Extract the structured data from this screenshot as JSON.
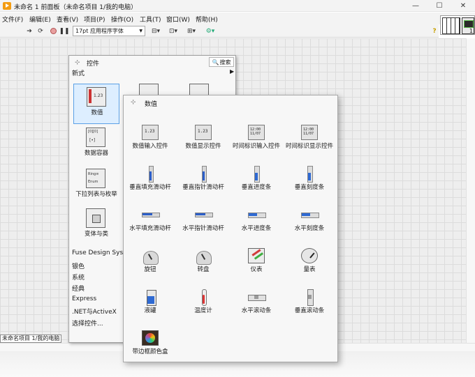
{
  "window": {
    "title": "未命名 1 前面板（未命名项目 1/我的电脑）",
    "minimize": "—",
    "maximize": "☐",
    "close": "✕"
  },
  "menu": [
    "文件(F)",
    "编辑(E)",
    "查看(V)",
    "项目(P)",
    "操作(O)",
    "工具(T)",
    "窗口(W)",
    "帮助(H)"
  ],
  "toolbar": {
    "font": "17pt 应用程序字体",
    "help": "?",
    "connector_number": "1"
  },
  "status_label": "未命名项目 1/我的电脑",
  "palette": {
    "title": "控件",
    "search": "搜索",
    "subtitle": "新式",
    "categories": [
      "数值",
      "数据容器",
      "下拉列表与枚举",
      "变体与类"
    ],
    "categories_selected": "数值",
    "list": [
      "Fuse Design Syste",
      "银色",
      "系统",
      "经典",
      "Express",
      ".NET与ActiveX",
      "选择控件..."
    ]
  },
  "subpalette": {
    "title": "数值",
    "items": [
      {
        "label": "数值输入控件",
        "icon": "numeric-control-icon"
      },
      {
        "label": "数值显示控件",
        "icon": "numeric-indicator-icon"
      },
      {
        "label": "时间标识输入控件",
        "icon": "time-stamp-control-icon"
      },
      {
        "label": "时间标识显示控件",
        "icon": "time-stamp-indicator-icon"
      },
      {
        "label": "垂直填充滑动杆",
        "icon": "vertical-fill-slide-icon"
      },
      {
        "label": "垂直指针滑动杆",
        "icon": "vertical-pointer-slide-icon"
      },
      {
        "label": "垂直进度条",
        "icon": "vertical-progress-bar-icon"
      },
      {
        "label": "垂直刻度条",
        "icon": "vertical-graduated-bar-icon"
      },
      {
        "label": "水平填充滑动杆",
        "icon": "horizontal-fill-slide-icon"
      },
      {
        "label": "水平指针滑动杆",
        "icon": "horizontal-pointer-slide-icon"
      },
      {
        "label": "水平进度条",
        "icon": "horizontal-progress-bar-icon"
      },
      {
        "label": "水平刻度条",
        "icon": "horizontal-graduated-bar-icon"
      },
      {
        "label": "旋钮",
        "icon": "knob-icon"
      },
      {
        "label": "转盘",
        "icon": "dial-icon"
      },
      {
        "label": "仪表",
        "icon": "meter-icon"
      },
      {
        "label": "量表",
        "icon": "gauge-icon"
      },
      {
        "label": "液罐",
        "icon": "tank-icon"
      },
      {
        "label": "温度计",
        "icon": "thermometer-icon"
      },
      {
        "label": "水平滚动条",
        "icon": "horizontal-scrollbar-icon"
      },
      {
        "label": "垂直滚动条",
        "icon": "vertical-scrollbar-icon"
      },
      {
        "label": "带边框颜色盒",
        "icon": "framed-color-box-icon"
      }
    ]
  },
  "colors": {
    "accent": "#f39c12",
    "selection": "#ddeeff",
    "fill_blue": "#2b5ec9"
  }
}
